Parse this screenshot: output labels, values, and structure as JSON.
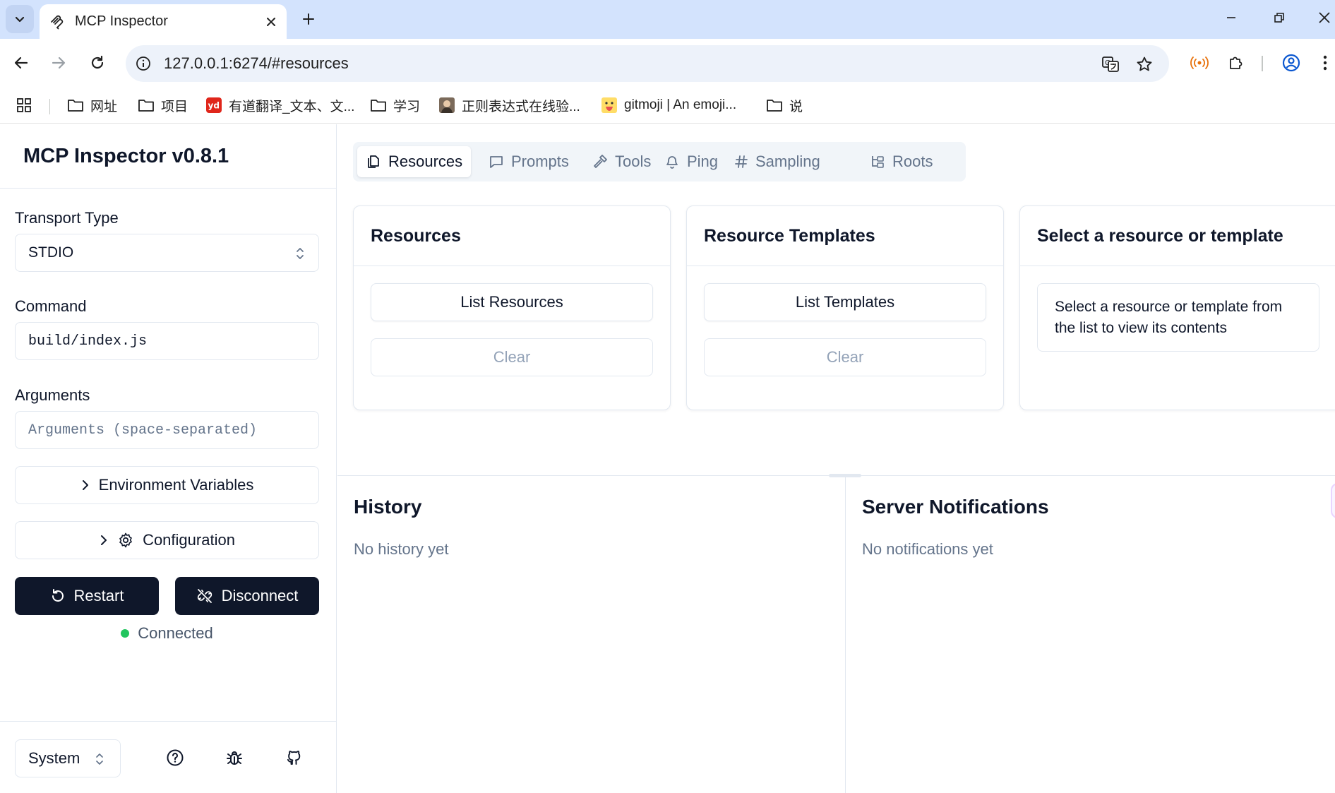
{
  "browser": {
    "tab_title": "MCP Inspector",
    "url": "127.0.0.1:6274/#resources",
    "bookmarks": [
      {
        "label": "网址",
        "icon": "folder-icon"
      },
      {
        "label": "项目",
        "icon": "folder-icon"
      },
      {
        "label": "有道翻译_文本、文...",
        "icon": "youdao-icon"
      },
      {
        "label": "学习",
        "icon": "folder-icon"
      },
      {
        "label": "正则表达式在线验...",
        "icon": "site-avatar-icon"
      },
      {
        "label": "gitmoji | An emoji...",
        "icon": "emoji-icon"
      },
      {
        "label": "说",
        "icon": "folder-icon"
      }
    ]
  },
  "sidebar": {
    "title": "MCP Inspector v0.8.1",
    "transport_label": "Transport Type",
    "transport_value": "STDIO",
    "command_label": "Command",
    "command_value": "build/index.js",
    "arguments_label": "Arguments",
    "arguments_placeholder": "Arguments (space-separated)",
    "env_button": "Environment Variables",
    "config_button": "Configuration",
    "restart_button": "Restart",
    "disconnect_button": "Disconnect",
    "status": "Connected",
    "theme_value": "System"
  },
  "tabs": [
    {
      "label": "Resources",
      "icon": "files-icon",
      "active": true
    },
    {
      "label": "Prompts",
      "icon": "message-square-icon",
      "active": false
    },
    {
      "label": "Tools",
      "icon": "hammer-icon",
      "active": false
    },
    {
      "label": "Ping",
      "icon": "bell-icon",
      "active": false
    },
    {
      "label": "Sampling",
      "icon": "hash-icon",
      "active": false
    },
    {
      "label": "Roots",
      "icon": "folder-tree-icon",
      "active": false
    }
  ],
  "resources_card": {
    "title": "Resources",
    "list_button": "List Resources",
    "clear_button": "Clear"
  },
  "templates_card": {
    "title": "Resource Templates",
    "list_button": "List Templates",
    "clear_button": "Clear"
  },
  "detail_card": {
    "title": "Select a resource or template",
    "message": "Select a resource or template from the list to view its contents"
  },
  "history": {
    "title": "History",
    "empty": "No history yet"
  },
  "notifications": {
    "title": "Server Notifications",
    "empty": "No notifications yet"
  },
  "colors": {
    "primary_button": "#0f172a",
    "status_dot": "#22c55e",
    "tabstrip": "#d3e3fd",
    "muted_text": "#64748b"
  }
}
